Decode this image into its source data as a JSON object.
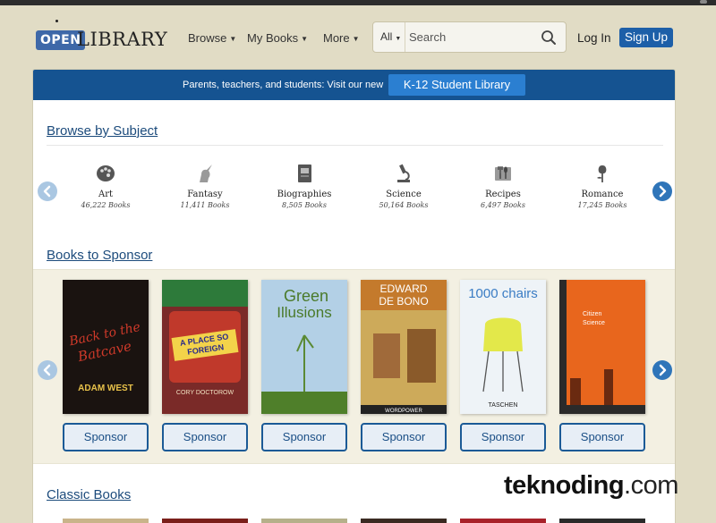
{
  "header": {
    "logo_open": "OPEN",
    "logo_library": "LIBRARY",
    "nav": [
      {
        "label": "Browse"
      },
      {
        "label": "My Books"
      },
      {
        "label": "More"
      }
    ],
    "search": {
      "scope": "All",
      "placeholder": "Search"
    },
    "login_label": "Log In",
    "signup_label": "Sign Up"
  },
  "banner": {
    "text": "Parents, teachers, and students: Visit our new",
    "button_label": "K-12 Student Library"
  },
  "browse_subject": {
    "title": "Browse by Subject",
    "subjects": [
      {
        "name": "Art",
        "count": "46,222 Books",
        "icon": "palette-icon"
      },
      {
        "name": "Fantasy",
        "count": "11,411 Books",
        "icon": "unicorn-icon"
      },
      {
        "name": "Biographies",
        "count": "8,505 Books",
        "icon": "book-icon"
      },
      {
        "name": "Science",
        "count": "50,164 Books",
        "icon": "microscope-icon"
      },
      {
        "name": "Recipes",
        "count": "6,497 Books",
        "icon": "recipes-icon"
      },
      {
        "name": "Romance",
        "count": "17,245 Books",
        "icon": "rose-icon"
      }
    ]
  },
  "sponsor": {
    "title": "Books to Sponsor",
    "button_label": "Sponsor",
    "books": [
      {
        "cover_lines": [
          "Back to the",
          "Batcave",
          "ADAM WEST"
        ],
        "bg": "#1a1310"
      },
      {
        "cover_lines": [
          "A PLACE SO",
          "FOREIGN",
          "CORY DOCTOROW"
        ],
        "bg": "#b0342a"
      },
      {
        "cover_lines": [
          "Green",
          "Illusions"
        ],
        "bg": "#a7c6de"
      },
      {
        "cover_lines": [
          "EDWARD",
          "DE BONO",
          "WORDPOWER"
        ],
        "bg": "#c5a256"
      },
      {
        "cover_lines": [
          "1000 chairs",
          "TASCHEN"
        ],
        "bg": "#eef3f7"
      },
      {
        "cover_lines": [
          "Citizen",
          "Science"
        ],
        "bg": "#e8631a"
      }
    ]
  },
  "classic": {
    "title": "Classic Books"
  },
  "watermark": {
    "brand": "teknoding",
    "domain": ".com"
  }
}
